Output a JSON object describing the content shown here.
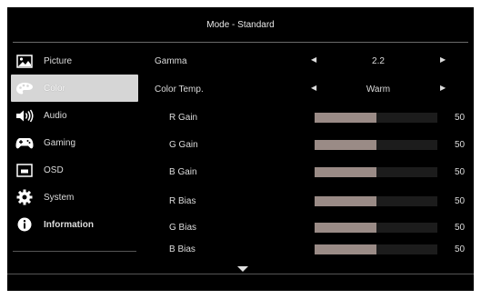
{
  "header": {
    "title": "Mode - Standard"
  },
  "sidebar": {
    "items": [
      {
        "label": "Picture",
        "icon": "picture-icon"
      },
      {
        "label": "Color",
        "icon": "palette-icon",
        "active": true
      },
      {
        "label": "Audio",
        "icon": "speaker-icon"
      },
      {
        "label": "Gaming",
        "icon": "gamepad-icon"
      },
      {
        "label": "OSD",
        "icon": "osd-window-icon"
      },
      {
        "label": "System",
        "icon": "gear-icon"
      },
      {
        "label": "Information",
        "icon": "info-icon"
      }
    ]
  },
  "settings": {
    "gamma": {
      "label": "Gamma",
      "value": "2.2"
    },
    "color_temp": {
      "label": "Color Temp.",
      "value": "Warm"
    },
    "sliders": [
      {
        "label": "R Gain",
        "value": "50",
        "level": 0.5
      },
      {
        "label": "G Gain",
        "value": "50",
        "level": 0.5
      },
      {
        "label": "B Gain",
        "value": "50",
        "level": 0.5
      },
      {
        "label": "R Bias",
        "value": "50",
        "level": 0.5
      },
      {
        "label": "G Bias",
        "value": "50",
        "level": 0.5
      },
      {
        "label": "B Bias",
        "value": "50",
        "level": 0.5
      }
    ]
  },
  "colors": {
    "background": "#000000",
    "active_item": "#d6d6d6",
    "slider_fill": "#9a8b86"
  }
}
